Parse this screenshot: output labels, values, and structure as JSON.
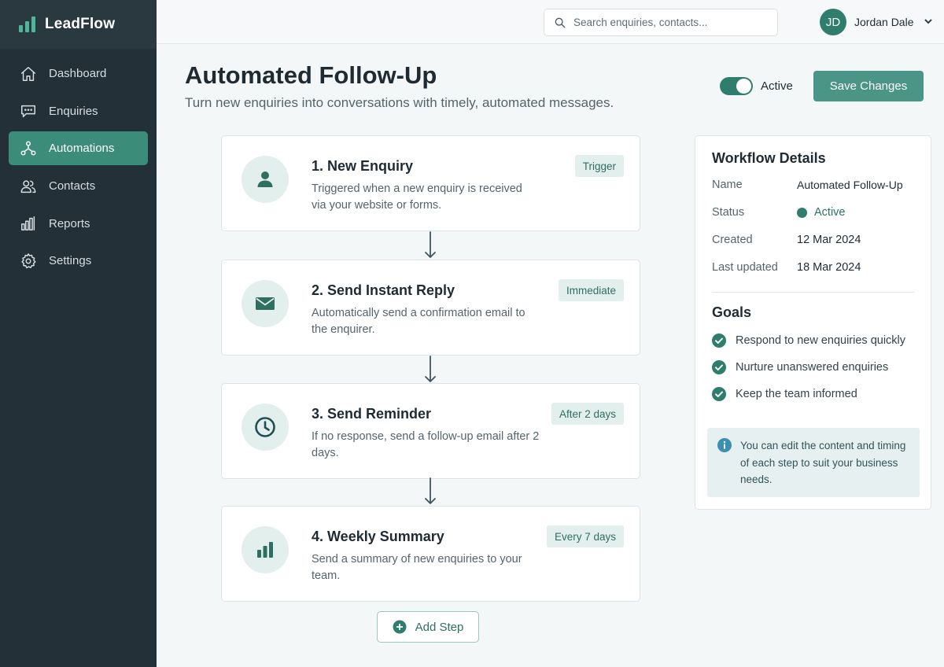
{
  "app": {
    "name": "LeadFlow"
  },
  "sidebar": {
    "items": [
      {
        "label": "Dashboard",
        "icon": "home-icon",
        "active": false
      },
      {
        "label": "Enquiries",
        "icon": "chat-icon",
        "active": false
      },
      {
        "label": "Automations",
        "icon": "workflow-icon",
        "active": true
      },
      {
        "label": "Contacts",
        "icon": "users-icon",
        "active": false
      },
      {
        "label": "Reports",
        "icon": "bar-chart-icon",
        "active": false
      },
      {
        "label": "Settings",
        "icon": "gear-icon",
        "active": false
      }
    ]
  },
  "topbar": {
    "search_placeholder": "Search enquiries, contacts...",
    "user": {
      "initials": "JD",
      "name": "Jordan Dale"
    }
  },
  "header": {
    "title": "Automated Follow-Up",
    "subtitle": "Turn new enquiries into conversations with timely, automated messages.",
    "toggle_label": "Active",
    "toggle_on": true,
    "save_label": "Save Changes"
  },
  "steps": [
    {
      "title": "1. New Enquiry",
      "description": "Triggered when a new enquiry is received via your website or forms.",
      "badge": "Trigger",
      "icon": "user-icon"
    },
    {
      "title": "2. Send Instant Reply",
      "description": "Automatically send a confirmation email to the enquirer.",
      "badge": "Immediate",
      "icon": "mail-icon"
    },
    {
      "title": "3. Send Reminder",
      "description": "If no response, send a follow-up email after 2 days.",
      "badge": "After 2 days",
      "icon": "clock-icon"
    },
    {
      "title": "4. Weekly Summary",
      "description": "Send a summary of new enquiries to your team.",
      "badge": "Every 7 days",
      "icon": "bar-chart-icon"
    }
  ],
  "add_step_label": "Add Step",
  "details": {
    "title": "Workflow Details",
    "rows": [
      {
        "label": "Name",
        "value": "Automated Follow-Up"
      },
      {
        "label": "Status",
        "value": "Active"
      },
      {
        "label": "Created",
        "value": "12 Mar 2024"
      },
      {
        "label": "Last updated",
        "value": "18 Mar 2024"
      }
    ],
    "goals_title": "Goals",
    "goals": [
      "Respond to new enquiries quickly",
      "Nurture unanswered enquiries",
      "Keep the team informed"
    ],
    "info_text": "You can edit the content and timing of each step to suit your business needs."
  },
  "colors": {
    "sidebar_bg": "#233038",
    "accent": "#2f7d6d",
    "active_nav": "#3c8c7a",
    "badge_bg": "#e3efed"
  }
}
